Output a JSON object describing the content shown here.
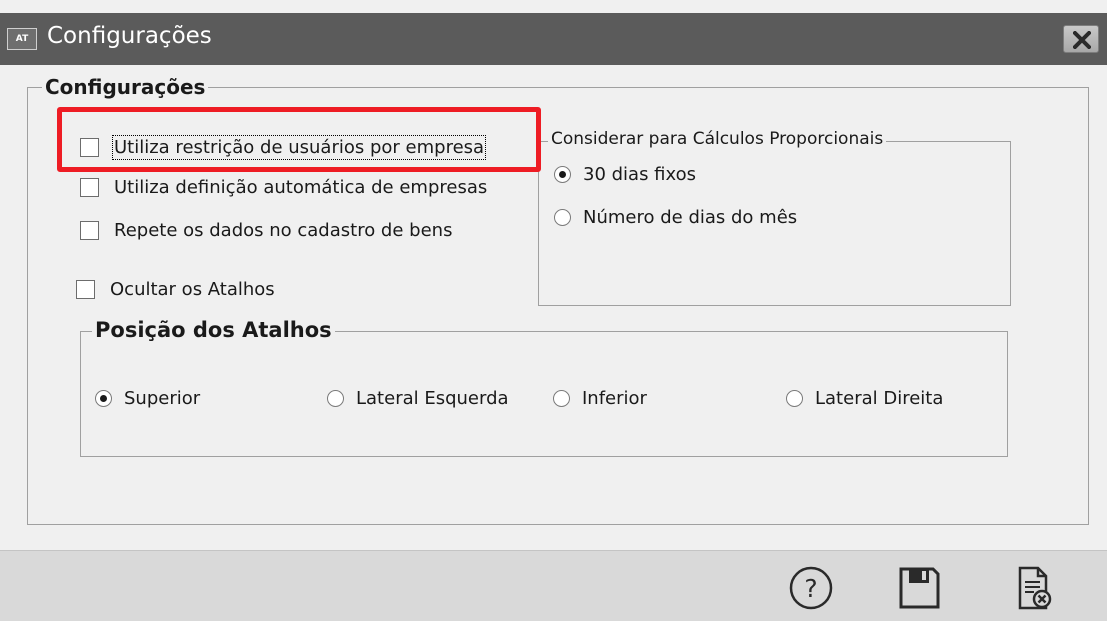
{
  "window": {
    "icon_text": "AT",
    "title": "Configurações"
  },
  "main_group": {
    "legend": "Configurações",
    "checkboxes": [
      {
        "label": "Utiliza restrição de usuários por empresa",
        "checked": false
      },
      {
        "label": "Utiliza definição automática de empresas",
        "checked": false
      },
      {
        "label": "Repete os dados no cadastro de bens",
        "checked": false
      },
      {
        "label": "Ocultar os Atalhos",
        "checked": false
      }
    ]
  },
  "proportional_group": {
    "legend": "Considerar para Cálculos Proporcionais",
    "options": [
      {
        "label": "30 dias fixos",
        "selected": true
      },
      {
        "label": "Número de dias do mês",
        "selected": false
      }
    ]
  },
  "shortcuts_group": {
    "legend": "Posição dos Atalhos",
    "options": [
      {
        "label": "Superior",
        "selected": true
      },
      {
        "label": "Lateral Esquerda",
        "selected": false
      },
      {
        "label": "Inferior",
        "selected": false
      },
      {
        "label": "Lateral Direita",
        "selected": false
      }
    ]
  },
  "footer": {
    "help_icon": "help-icon",
    "save_icon": "save-icon",
    "close_icon": "close-document-icon"
  },
  "colors": {
    "titlebar": "#5b5b5b",
    "highlight": "#ee1c24",
    "background": "#f0f0f0",
    "footer": "#d9d9d9"
  }
}
